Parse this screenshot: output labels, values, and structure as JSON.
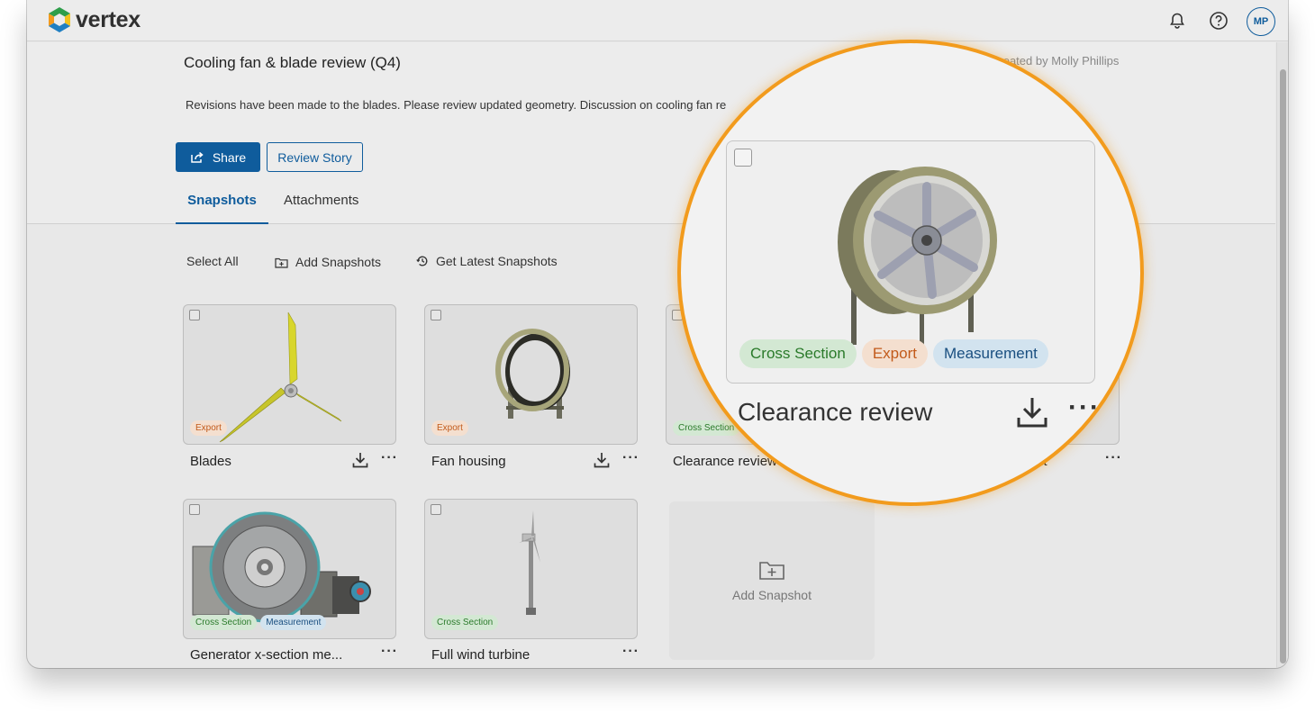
{
  "app": {
    "name": "vertex",
    "user_initials": "MP"
  },
  "header": {
    "title": "Cooling fan & blade review (Q4)",
    "created_by": "Created by Molly Phillips",
    "description": "Revisions have been made to the blades. Please review updated geometry. Discussion on cooling fan re",
    "share_label": "Share",
    "review_story_label": "Review Story"
  },
  "tabs": [
    {
      "label": "Snapshots",
      "active": true
    },
    {
      "label": "Attachments",
      "active": false
    }
  ],
  "toolbar": {
    "select_all": "Select All",
    "add_snapshots": "Add Snapshots",
    "get_latest": "Get Latest Snapshots"
  },
  "tag_labels": {
    "cross_section": "Cross Section",
    "export": "Export",
    "measurement": "Measurement"
  },
  "snapshots": [
    {
      "name": "Blades",
      "tags": [
        "Export"
      ],
      "downloadable": true
    },
    {
      "name": "Fan housing",
      "tags": [
        "Export"
      ],
      "downloadable": true
    },
    {
      "name": "Clearance review",
      "tags": [
        "Cross Section",
        "Export",
        "Measurement"
      ],
      "downloadable": true
    },
    {
      "name": "nt",
      "tags": [],
      "downloadable": false
    },
    {
      "name": "Generator x-section me...",
      "tags": [
        "Cross Section",
        "Measurement"
      ],
      "downloadable": false
    },
    {
      "name": "Full wind turbine",
      "tags": [
        "Cross Section"
      ],
      "downloadable": false
    }
  ],
  "add_snapshot_label": "Add Snapshot",
  "zoom": {
    "title": "Clearance review"
  },
  "colors": {
    "primary": "#0f5c9c",
    "highlight_ring": "#f29b1d"
  }
}
